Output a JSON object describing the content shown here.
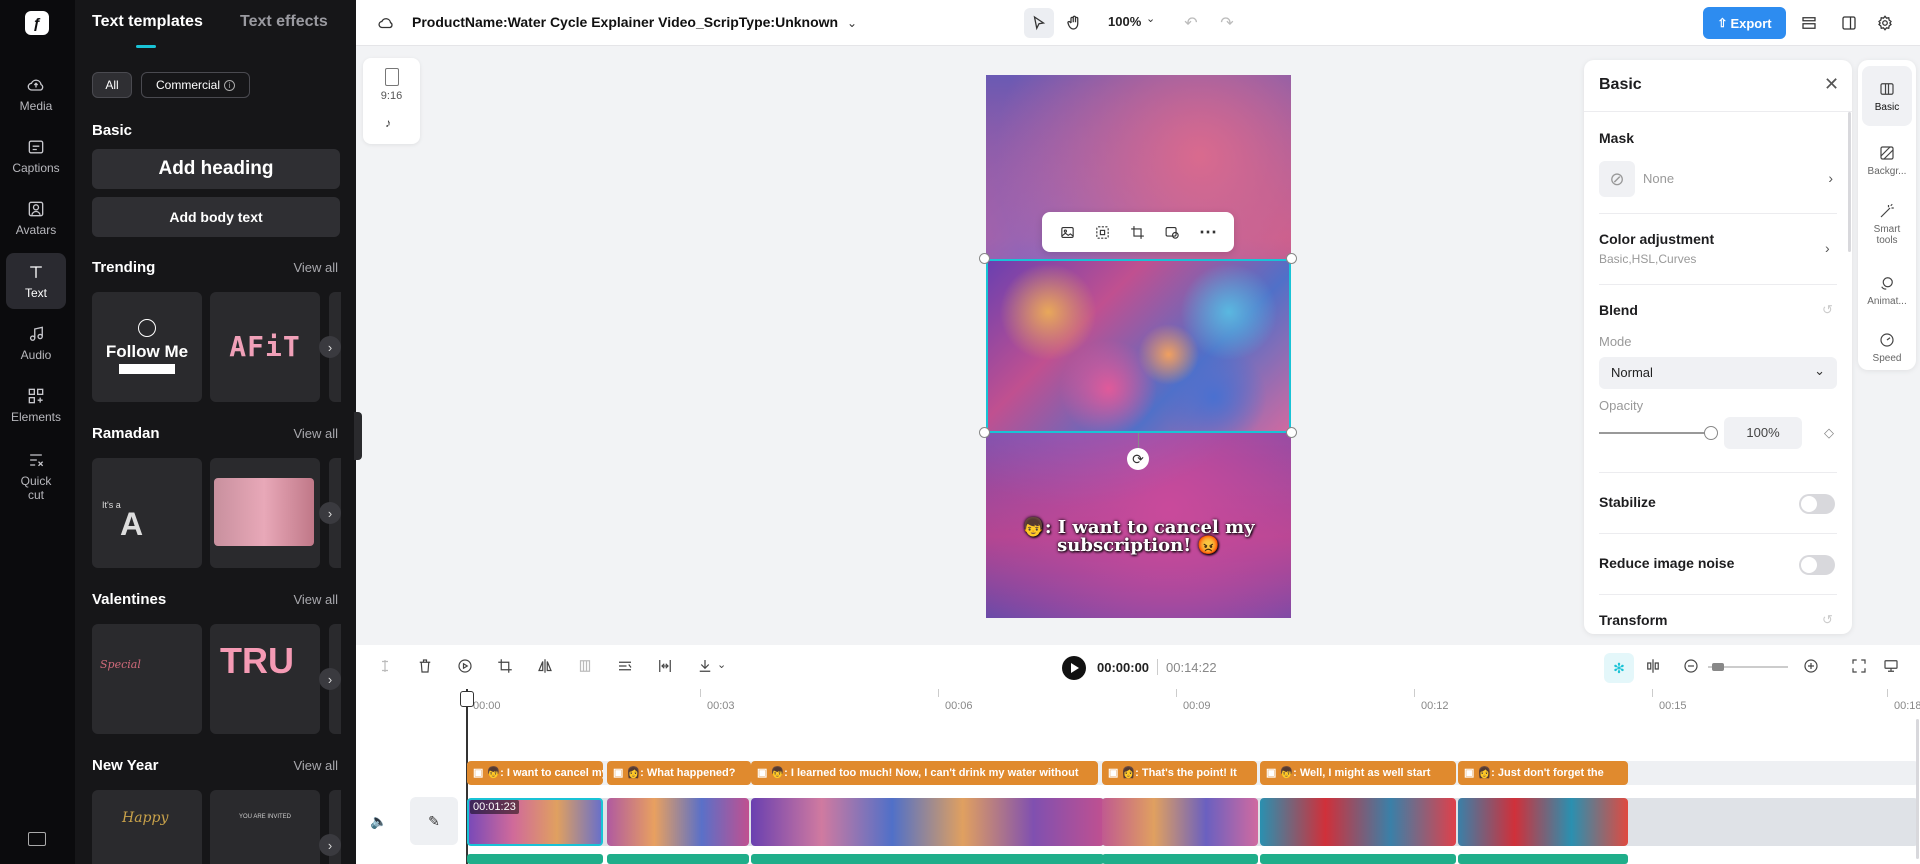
{
  "app": {
    "project_title": "ProductName:Water Cycle Explainer Video_ScripType:Unknown",
    "zoom": "100%",
    "export_label": "Export",
    "accent_color": "#2d8cf0",
    "selection_color": "#19c3d6"
  },
  "rail": {
    "items": [
      {
        "label": "Media",
        "icon": "cloud-upload-icon"
      },
      {
        "label": "Captions",
        "icon": "captions-icon"
      },
      {
        "label": "Avatars",
        "icon": "avatar-icon"
      },
      {
        "label": "Text",
        "icon": "text-icon",
        "active": true
      },
      {
        "label": "Audio",
        "icon": "music-icon"
      },
      {
        "label": "Elements",
        "icon": "elements-icon"
      },
      {
        "label": "Quick cut",
        "icon": "scissors-icon"
      }
    ]
  },
  "panel": {
    "tabs": [
      "Text templates",
      "Text effects"
    ],
    "filters": [
      "All",
      "Commercial"
    ],
    "basic_title": "Basic",
    "add_heading": "Add heading",
    "add_body": "Add body text",
    "view_all": "View all",
    "sections": [
      {
        "title": "Trending",
        "cards": [
          "Follow Me",
          "AFiT"
        ]
      },
      {
        "title": "Ramadan",
        "cards": [
          "It's a",
          "A"
        ]
      },
      {
        "title": "Valentines",
        "cards": [
          "Special",
          "TRU"
        ]
      },
      {
        "title": "New Year",
        "cards": [
          "Happy",
          "YOU ARE INVITED"
        ]
      }
    ]
  },
  "canvas": {
    "ratio": "9:16",
    "caption_text": "👦: I want to cancel my subscription! 😡"
  },
  "props": {
    "title": "Basic",
    "mask_label": "Mask",
    "mask_value": "None",
    "color_adj_label": "Color adjustment",
    "color_adj_sub": "Basic,HSL,Curves",
    "blend_label": "Blend",
    "mode_label": "Mode",
    "mode_value": "Normal",
    "opacity_label": "Opacity",
    "opacity_value": "100%",
    "opacity_fraction": 1.0,
    "stabilize_label": "Stabilize",
    "noise_label": "Reduce image noise",
    "transform_label": "Transform"
  },
  "strip": {
    "items": [
      {
        "label": "Basic",
        "icon": "basic-icon",
        "active": true
      },
      {
        "label": "Backgr...",
        "icon": "background-icon"
      },
      {
        "label": "Smart tools",
        "icon": "magic-wand-icon"
      },
      {
        "label": "Animat...",
        "icon": "animation-icon"
      },
      {
        "label": "Speed",
        "icon": "speed-icon"
      }
    ]
  },
  "timeline": {
    "current_time": "00:00:00",
    "total_time": "00:14:22",
    "ruler": [
      "00:00",
      "00:03",
      "00:06",
      "00:09",
      "00:12",
      "00:15",
      "00:18"
    ],
    "clip_duration_badge": "00:01:23",
    "captions": [
      "👦: I want to cancel my subscription!",
      "👩: What happened?",
      "👦: I learned too much! Now, I can't drink my water without",
      "👩: That's the point! It",
      "👦: Well, I might as well start",
      "👩: Just don't forget the"
    ]
  }
}
